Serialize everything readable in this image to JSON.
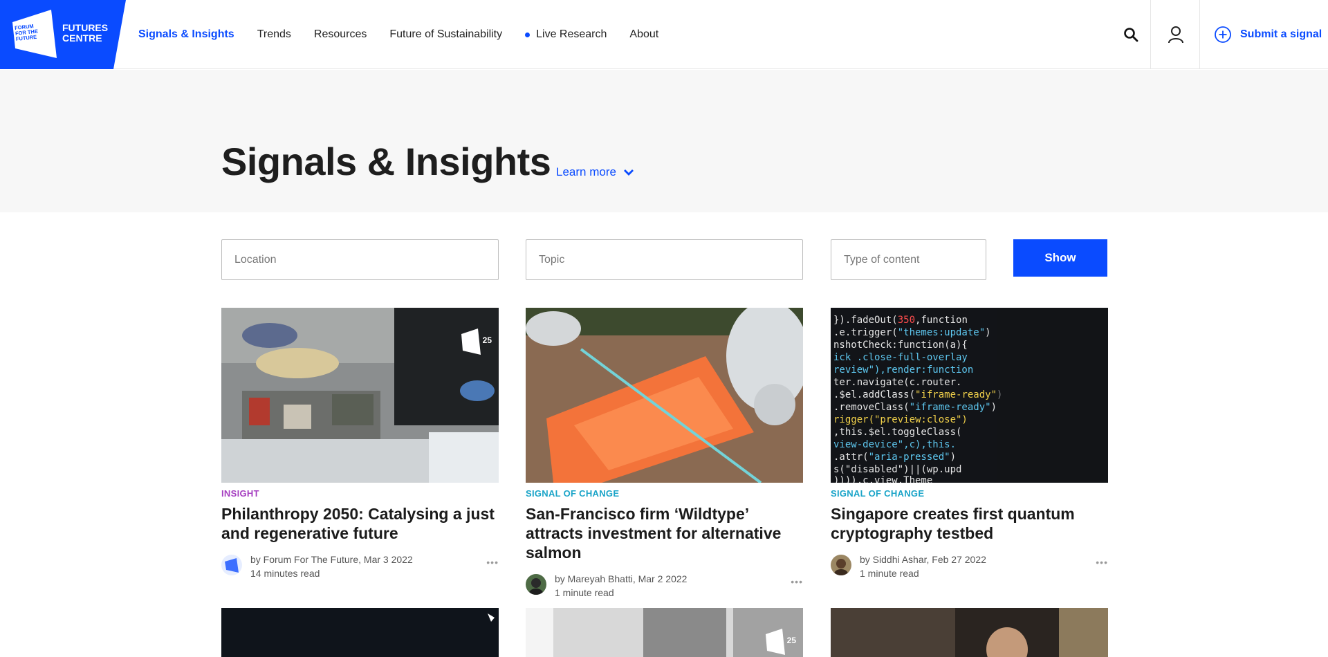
{
  "logo": {
    "mark_text": "FORUM FOR THE FUTURE",
    "name": "FUTURES CENTRE"
  },
  "nav": [
    {
      "label": "Signals & Insights",
      "active": true
    },
    {
      "label": "Trends"
    },
    {
      "label": "Resources"
    },
    {
      "label": "Future of Sustainability"
    },
    {
      "label": "Live Research",
      "live": true
    },
    {
      "label": "About"
    }
  ],
  "header": {
    "submit_label": "Submit a signal"
  },
  "hero": {
    "title": "Signals & Insights",
    "learn_more": "Learn more"
  },
  "filters": {
    "location_placeholder": "Location",
    "topic_placeholder": "Topic",
    "type_placeholder": "Type of content",
    "show_label": "Show"
  },
  "cards": [
    {
      "category": "INSIGHT",
      "title": "Philanthropy 2050: Catalysing a just and regenerative future",
      "byline": "by Forum For The Future, Mar 3 2022",
      "read_time": "14 minutes read",
      "badge": "25"
    },
    {
      "category": "SIGNAL OF CHANGE",
      "title": "San-Francisco firm ‘Wildtype’ attracts investment for alternative salmon",
      "byline": "by Mareyah Bhatti, Mar 2 2022",
      "read_time": "1 minute read"
    },
    {
      "category": "SIGNAL OF CHANGE",
      "title": "Singapore creates first quantum cryptography testbed",
      "byline": "by Siddhi Ashar, Feb 27 2022",
      "read_time": "1 minute read"
    }
  ],
  "colors": {
    "brand": "#0a4bff",
    "insight": "#a53ec0",
    "signal": "#1aa4c8"
  },
  "badge2": "25"
}
